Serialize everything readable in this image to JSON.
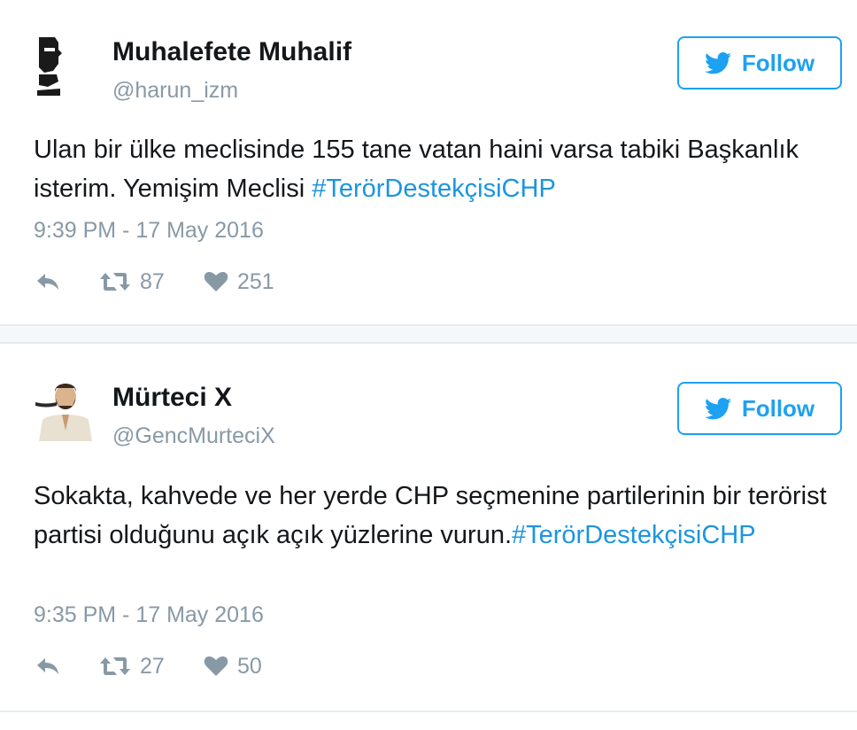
{
  "colors": {
    "brand_blue": "#1da1f2",
    "hashtag_blue": "#1b95e0",
    "muted_gray": "#8899a6",
    "text_dark": "#14171a"
  },
  "icons": {
    "follow": "twitter-bird-icon",
    "reply": "reply-arrow-icon",
    "retweet": "retweet-icon",
    "like": "heart-icon"
  },
  "tweets": [
    {
      "display_name": "Muhalefete Muhalif",
      "handle": "@harun_izm",
      "follow_label": "Follow",
      "text_plain": "Ulan bir ülke meclisinde 155 tane vatan haini varsa tabiki Başkanlık isterim. Yemişim Meclisi ",
      "hashtag": "#TerörDestekçisiCHP",
      "timestamp": "9:39 PM - 17 May 2016",
      "retweets": "87",
      "likes": "251"
    },
    {
      "display_name": "Mürteci X",
      "handle": "@GencMurteciX",
      "follow_label": "Follow",
      "text_plain": "Sokakta, kahvede ve her yerde CHP seçmenine partilerinin bir terörist partisi olduğunu açık açık yüzlerine vurun.",
      "hashtag": "#TerörDestekçisiCHP",
      "timestamp": "9:35 PM - 17 May 2016",
      "retweets": "27",
      "likes": "50"
    }
  ]
}
